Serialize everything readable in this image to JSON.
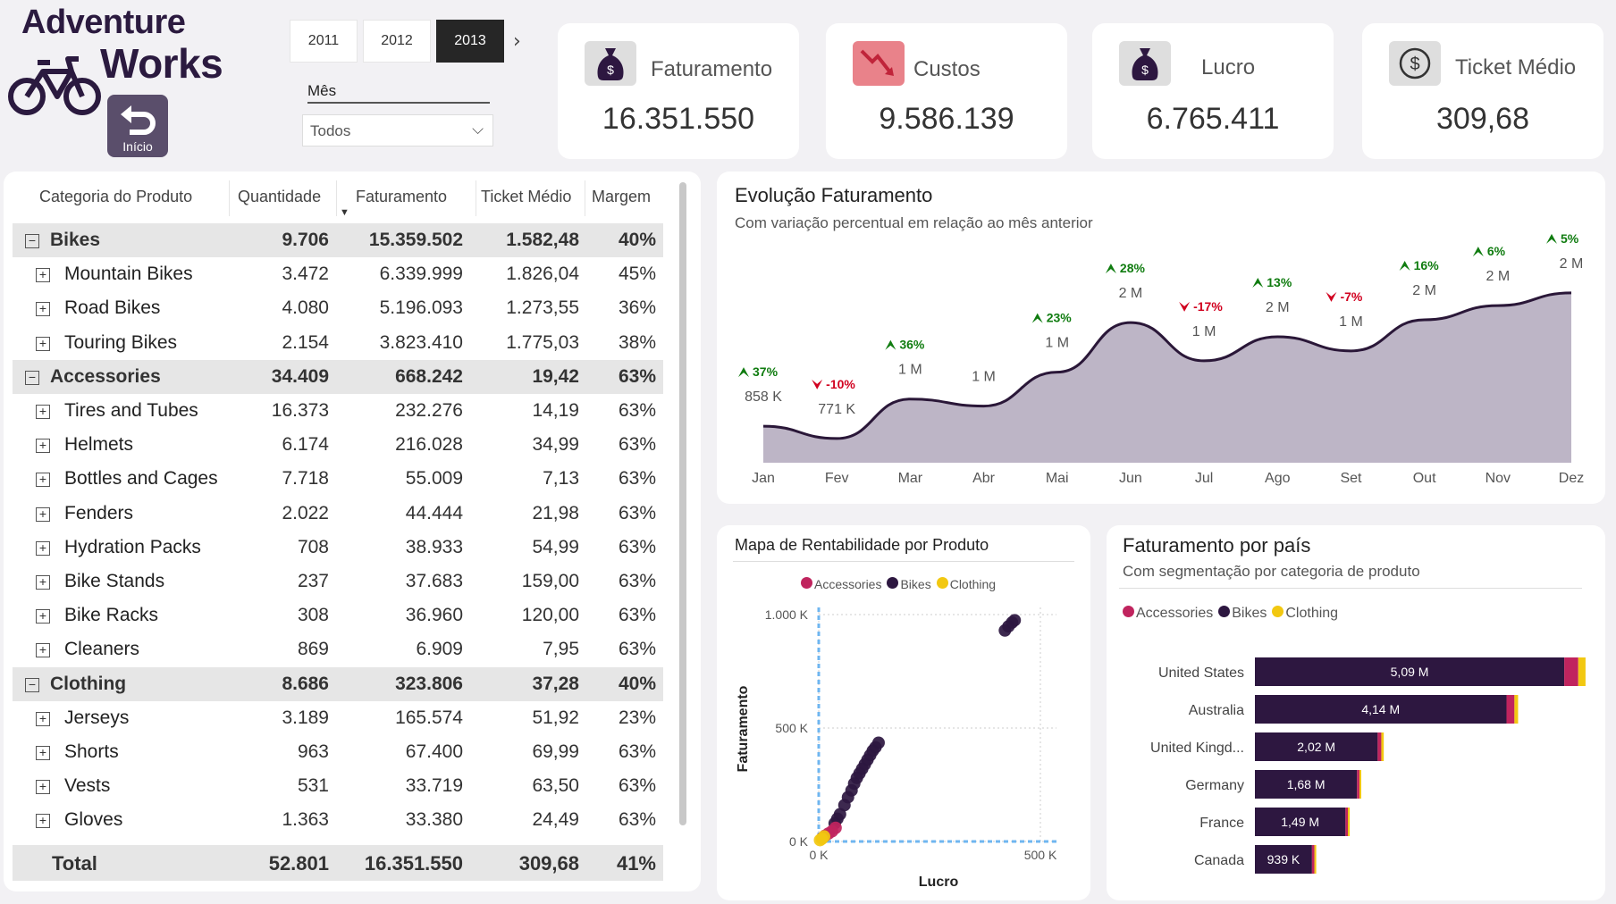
{
  "logo": {
    "line1": "Adventure",
    "line2": "Works"
  },
  "home_button": {
    "label": "Início"
  },
  "years": [
    {
      "label": "2011",
      "selected": false
    },
    {
      "label": "2012",
      "selected": false
    },
    {
      "label": "2013",
      "selected": true
    }
  ],
  "month_filter": {
    "label": "Mês",
    "value": "Todos"
  },
  "kpis": [
    {
      "label": "Faturamento",
      "value": "16.351.550",
      "icon": "money-bag-icon"
    },
    {
      "label": "Custos",
      "value": "9.586.139",
      "icon": "chart-down-icon"
    },
    {
      "label": "Lucro",
      "value": "6.765.411",
      "icon": "money-bag-icon"
    },
    {
      "label": "Ticket Médio",
      "value": "309,68",
      "icon": "dollar-coin-icon"
    }
  ],
  "table": {
    "headers": [
      "Categoria do Produto",
      "Quantidade",
      "Faturamento",
      "Ticket Médio",
      "Margem"
    ],
    "rows": [
      {
        "type": "group",
        "cat": "Bikes",
        "qty": "9.706",
        "fat": "15.359.502",
        "tm": "1.582,48",
        "mg": "40%"
      },
      {
        "type": "sub",
        "cat": "Mountain Bikes",
        "qty": "3.472",
        "fat": "6.339.999",
        "tm": "1.826,04",
        "mg": "45%"
      },
      {
        "type": "sub",
        "cat": "Road Bikes",
        "qty": "4.080",
        "fat": "5.196.093",
        "tm": "1.273,55",
        "mg": "36%"
      },
      {
        "type": "sub",
        "cat": "Touring Bikes",
        "qty": "2.154",
        "fat": "3.823.410",
        "tm": "1.775,03",
        "mg": "38%"
      },
      {
        "type": "group",
        "cat": "Accessories",
        "qty": "34.409",
        "fat": "668.242",
        "tm": "19,42",
        "mg": "63%"
      },
      {
        "type": "sub",
        "cat": "Tires and Tubes",
        "qty": "16.373",
        "fat": "232.276",
        "tm": "14,19",
        "mg": "63%"
      },
      {
        "type": "sub",
        "cat": "Helmets",
        "qty": "6.174",
        "fat": "216.028",
        "tm": "34,99",
        "mg": "63%"
      },
      {
        "type": "sub",
        "cat": "Bottles and Cages",
        "qty": "7.718",
        "fat": "55.009",
        "tm": "7,13",
        "mg": "63%"
      },
      {
        "type": "sub",
        "cat": "Fenders",
        "qty": "2.022",
        "fat": "44.444",
        "tm": "21,98",
        "mg": "63%"
      },
      {
        "type": "sub",
        "cat": "Hydration Packs",
        "qty": "708",
        "fat": "38.933",
        "tm": "54,99",
        "mg": "63%"
      },
      {
        "type": "sub",
        "cat": "Bike Stands",
        "qty": "237",
        "fat": "37.683",
        "tm": "159,00",
        "mg": "63%"
      },
      {
        "type": "sub",
        "cat": "Bike Racks",
        "qty": "308",
        "fat": "36.960",
        "tm": "120,00",
        "mg": "63%"
      },
      {
        "type": "sub",
        "cat": "Cleaners",
        "qty": "869",
        "fat": "6.909",
        "tm": "7,95",
        "mg": "63%"
      },
      {
        "type": "group",
        "cat": "Clothing",
        "qty": "8.686",
        "fat": "323.806",
        "tm": "37,28",
        "mg": "40%"
      },
      {
        "type": "sub",
        "cat": "Jerseys",
        "qty": "3.189",
        "fat": "165.574",
        "tm": "51,92",
        "mg": "23%"
      },
      {
        "type": "sub",
        "cat": "Shorts",
        "qty": "963",
        "fat": "67.400",
        "tm": "69,99",
        "mg": "63%"
      },
      {
        "type": "sub",
        "cat": "Vests",
        "qty": "531",
        "fat": "33.719",
        "tm": "63,50",
        "mg": "63%"
      },
      {
        "type": "sub",
        "cat": "Gloves",
        "qty": "1.363",
        "fat": "33.380",
        "tm": "24,49",
        "mg": "63%"
      }
    ],
    "total": {
      "cat": "Total",
      "qty": "52.801",
      "fat": "16.351.550",
      "tm": "309,68",
      "mg": "41%"
    }
  },
  "chart_data": [
    {
      "type": "area",
      "title": "Evolução Faturamento",
      "subtitle": "Com variação percentual em relação ao mês anterior",
      "categories": [
        "Jan",
        "Fev",
        "Mar",
        "Abr",
        "Mai",
        "Jun",
        "Jul",
        "Ago",
        "Set",
        "Out",
        "Nov",
        "Dez"
      ],
      "values": [
        858000,
        771000,
        1050000,
        1000000,
        1240000,
        1590000,
        1320000,
        1490000,
        1390000,
        1610000,
        1710000,
        1800000
      ],
      "value_labels": [
        "858 K",
        "771 K",
        "1 M",
        "1 M",
        "1 M",
        "2 M",
        "1 M",
        "2 M",
        "1 M",
        "2 M",
        "2 M",
        "2 M"
      ],
      "pct_change": [
        "37%",
        "-10%",
        "36%",
        "",
        "23%",
        "28%",
        "-17%",
        "13%",
        "-7%",
        "16%",
        "6%",
        "5%"
      ],
      "colors": {
        "fill": "#bdb5c6",
        "line": "#2a1738",
        "up": "#107c10",
        "down": "#d1001f"
      }
    },
    {
      "type": "scatter",
      "title": "Mapa de Rentabilidade por Produto",
      "xlabel": "Lucro",
      "ylabel": "Faturamento",
      "xlim": [
        0,
        1000000
      ],
      "ylim": [
        0,
        1000000
      ],
      "x_ticks": [
        "0 K",
        "500 K"
      ],
      "y_ticks": [
        "0 K",
        "500 K",
        "1.000 K"
      ],
      "legend": [
        "Accessories",
        "Bikes",
        "Clothing"
      ],
      "series": [
        {
          "name": "Bikes",
          "color": "#2d1740",
          "points": [
            [
              420000,
              930000
            ],
            [
              428000,
              948000
            ],
            [
              436000,
              965000
            ],
            [
              442000,
              975000
            ],
            [
              135000,
              435000
            ],
            [
              128000,
              415000
            ],
            [
              122000,
              400000
            ],
            [
              116000,
              380000
            ],
            [
              110000,
              360000
            ],
            [
              104000,
              340000
            ],
            [
              98000,
              320000
            ],
            [
              92000,
              300000
            ],
            [
              86000,
              280000
            ],
            [
              80000,
              255000
            ],
            [
              74000,
              225000
            ],
            [
              66000,
              195000
            ],
            [
              58000,
              160000
            ],
            [
              48000,
              120000
            ],
            [
              42000,
              100000
            ],
            [
              36000,
              80000
            ]
          ]
        },
        {
          "name": "Accessories",
          "color": "#c0245e",
          "points": [
            [
              38000,
              60000
            ],
            [
              30000,
              45000
            ],
            [
              22000,
              35000
            ],
            [
              14000,
              25000
            ],
            [
              8000,
              15000
            ]
          ]
        },
        {
          "name": "Clothing",
          "color": "#f2c811",
          "points": [
            [
              12000,
              22000
            ],
            [
              7000,
              12000
            ],
            [
              3000,
              6000
            ]
          ]
        }
      ]
    },
    {
      "type": "bar",
      "title": "Faturamento por país",
      "subtitle": "Com segmentação por categoria de produto",
      "legend": [
        "Accessories",
        "Bikes",
        "Clothing"
      ],
      "categories": [
        "United States",
        "Australia",
        "United Kingd...",
        "Germany",
        "France",
        "Canada"
      ],
      "series": [
        {
          "name": "Bikes",
          "color": "#2d1740",
          "values": [
            5090000,
            4140000,
            2020000,
            1680000,
            1490000,
            939000
          ]
        },
        {
          "name": "Accessories",
          "color": "#c0245e",
          "values": [
            230000,
            130000,
            60000,
            40000,
            40000,
            40000
          ]
        },
        {
          "name": "Clothing",
          "color": "#f2c811",
          "values": [
            120000,
            60000,
            40000,
            30000,
            30000,
            30000
          ]
        }
      ],
      "bar_labels": [
        "5,09 M",
        "4,14 M",
        "2,02 M",
        "1,68 M",
        "1,49 M",
        "939 K"
      ],
      "xlim": [
        0,
        5500000
      ]
    }
  ]
}
